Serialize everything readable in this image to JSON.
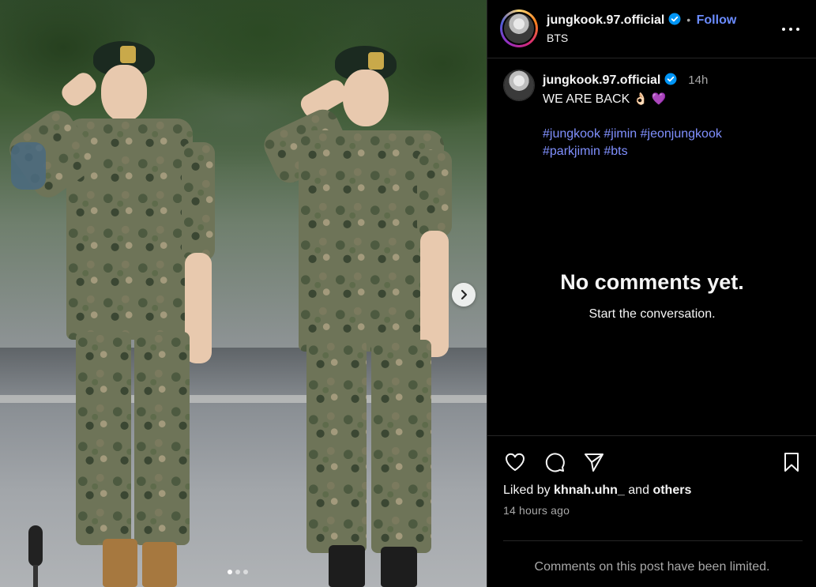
{
  "post": {
    "image_alt": "Two soldiers in camouflage uniforms saluting",
    "carousel_dots": 3,
    "active_dot": 0
  },
  "header": {
    "username": "jungkook.97.official",
    "separator": "•",
    "follow_label": "Follow",
    "subtitle": "BTS"
  },
  "caption": {
    "username": "jungkook.97.official",
    "time_ago": "14h",
    "text": "WE ARE BACK",
    "emojis": "👌🏻 💜",
    "hashtags": [
      "#jungkook",
      "#jimin",
      "#jeonjungkook",
      "#parkjimin",
      "#bts"
    ]
  },
  "comments": {
    "empty_title": "No comments yet.",
    "empty_subtitle": "Start the conversation."
  },
  "footer": {
    "liked_prefix": "Liked by",
    "liked_user": "khnah.uhn_",
    "liked_and": "and",
    "liked_others": "others",
    "timestamp": "14 hours ago",
    "limited_notice": "Comments on this post have been limited."
  },
  "colors": {
    "background": "#000000",
    "link": "#6b8cff",
    "hashtag": "#8090ff",
    "muted": "#a8a8a8",
    "verified": "#0095f6",
    "divider": "#262626"
  },
  "icons": [
    "carousel-next-icon",
    "more-options-icon",
    "verified-badge-icon",
    "like-heart-icon",
    "comment-icon",
    "share-send-icon",
    "save-bookmark-icon"
  ]
}
